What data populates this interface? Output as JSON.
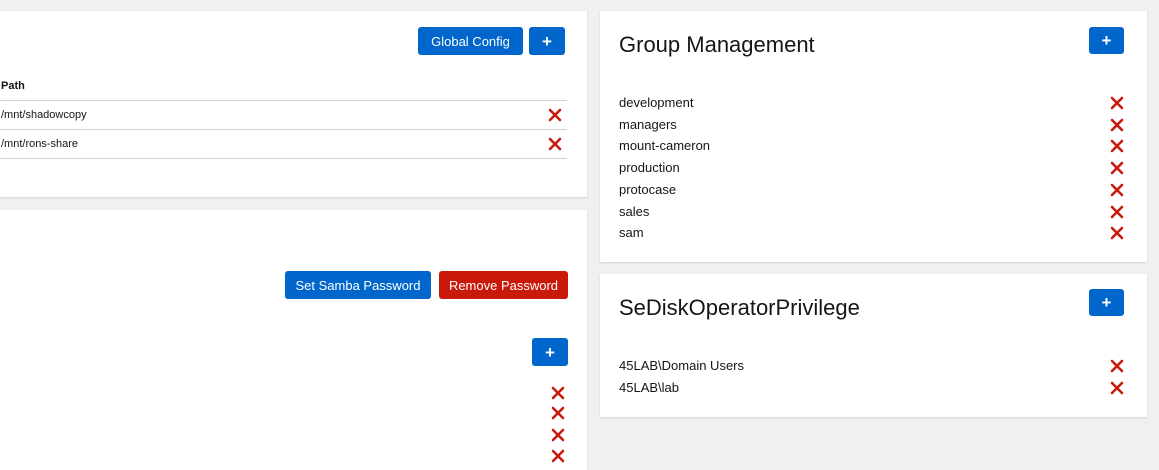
{
  "shares_card": {
    "global_config_label": "Global Config",
    "add_label": "+",
    "table_header_path": "Path",
    "rows": [
      {
        "path": "/mnt/shadowcopy"
      },
      {
        "path": "/mnt/rons-share"
      }
    ]
  },
  "users_card": {
    "set_password_label": "Set Samba Password",
    "remove_password_label": "Remove Password",
    "add_label": "+"
  },
  "group_management": {
    "title": "Group Management",
    "add_label": "+",
    "groups": [
      "development",
      "managers",
      "mount-cameron",
      "production",
      "protocase",
      "sales",
      "sam"
    ]
  },
  "privilege": {
    "title": "SeDiskOperatorPrivilege",
    "add_label": "+",
    "members": [
      "45LAB\\Domain Users",
      "45LAB\\lab"
    ]
  },
  "colors": {
    "primary": "#0066cc",
    "danger": "#c9190b",
    "delete_icon": "#c9190b"
  }
}
